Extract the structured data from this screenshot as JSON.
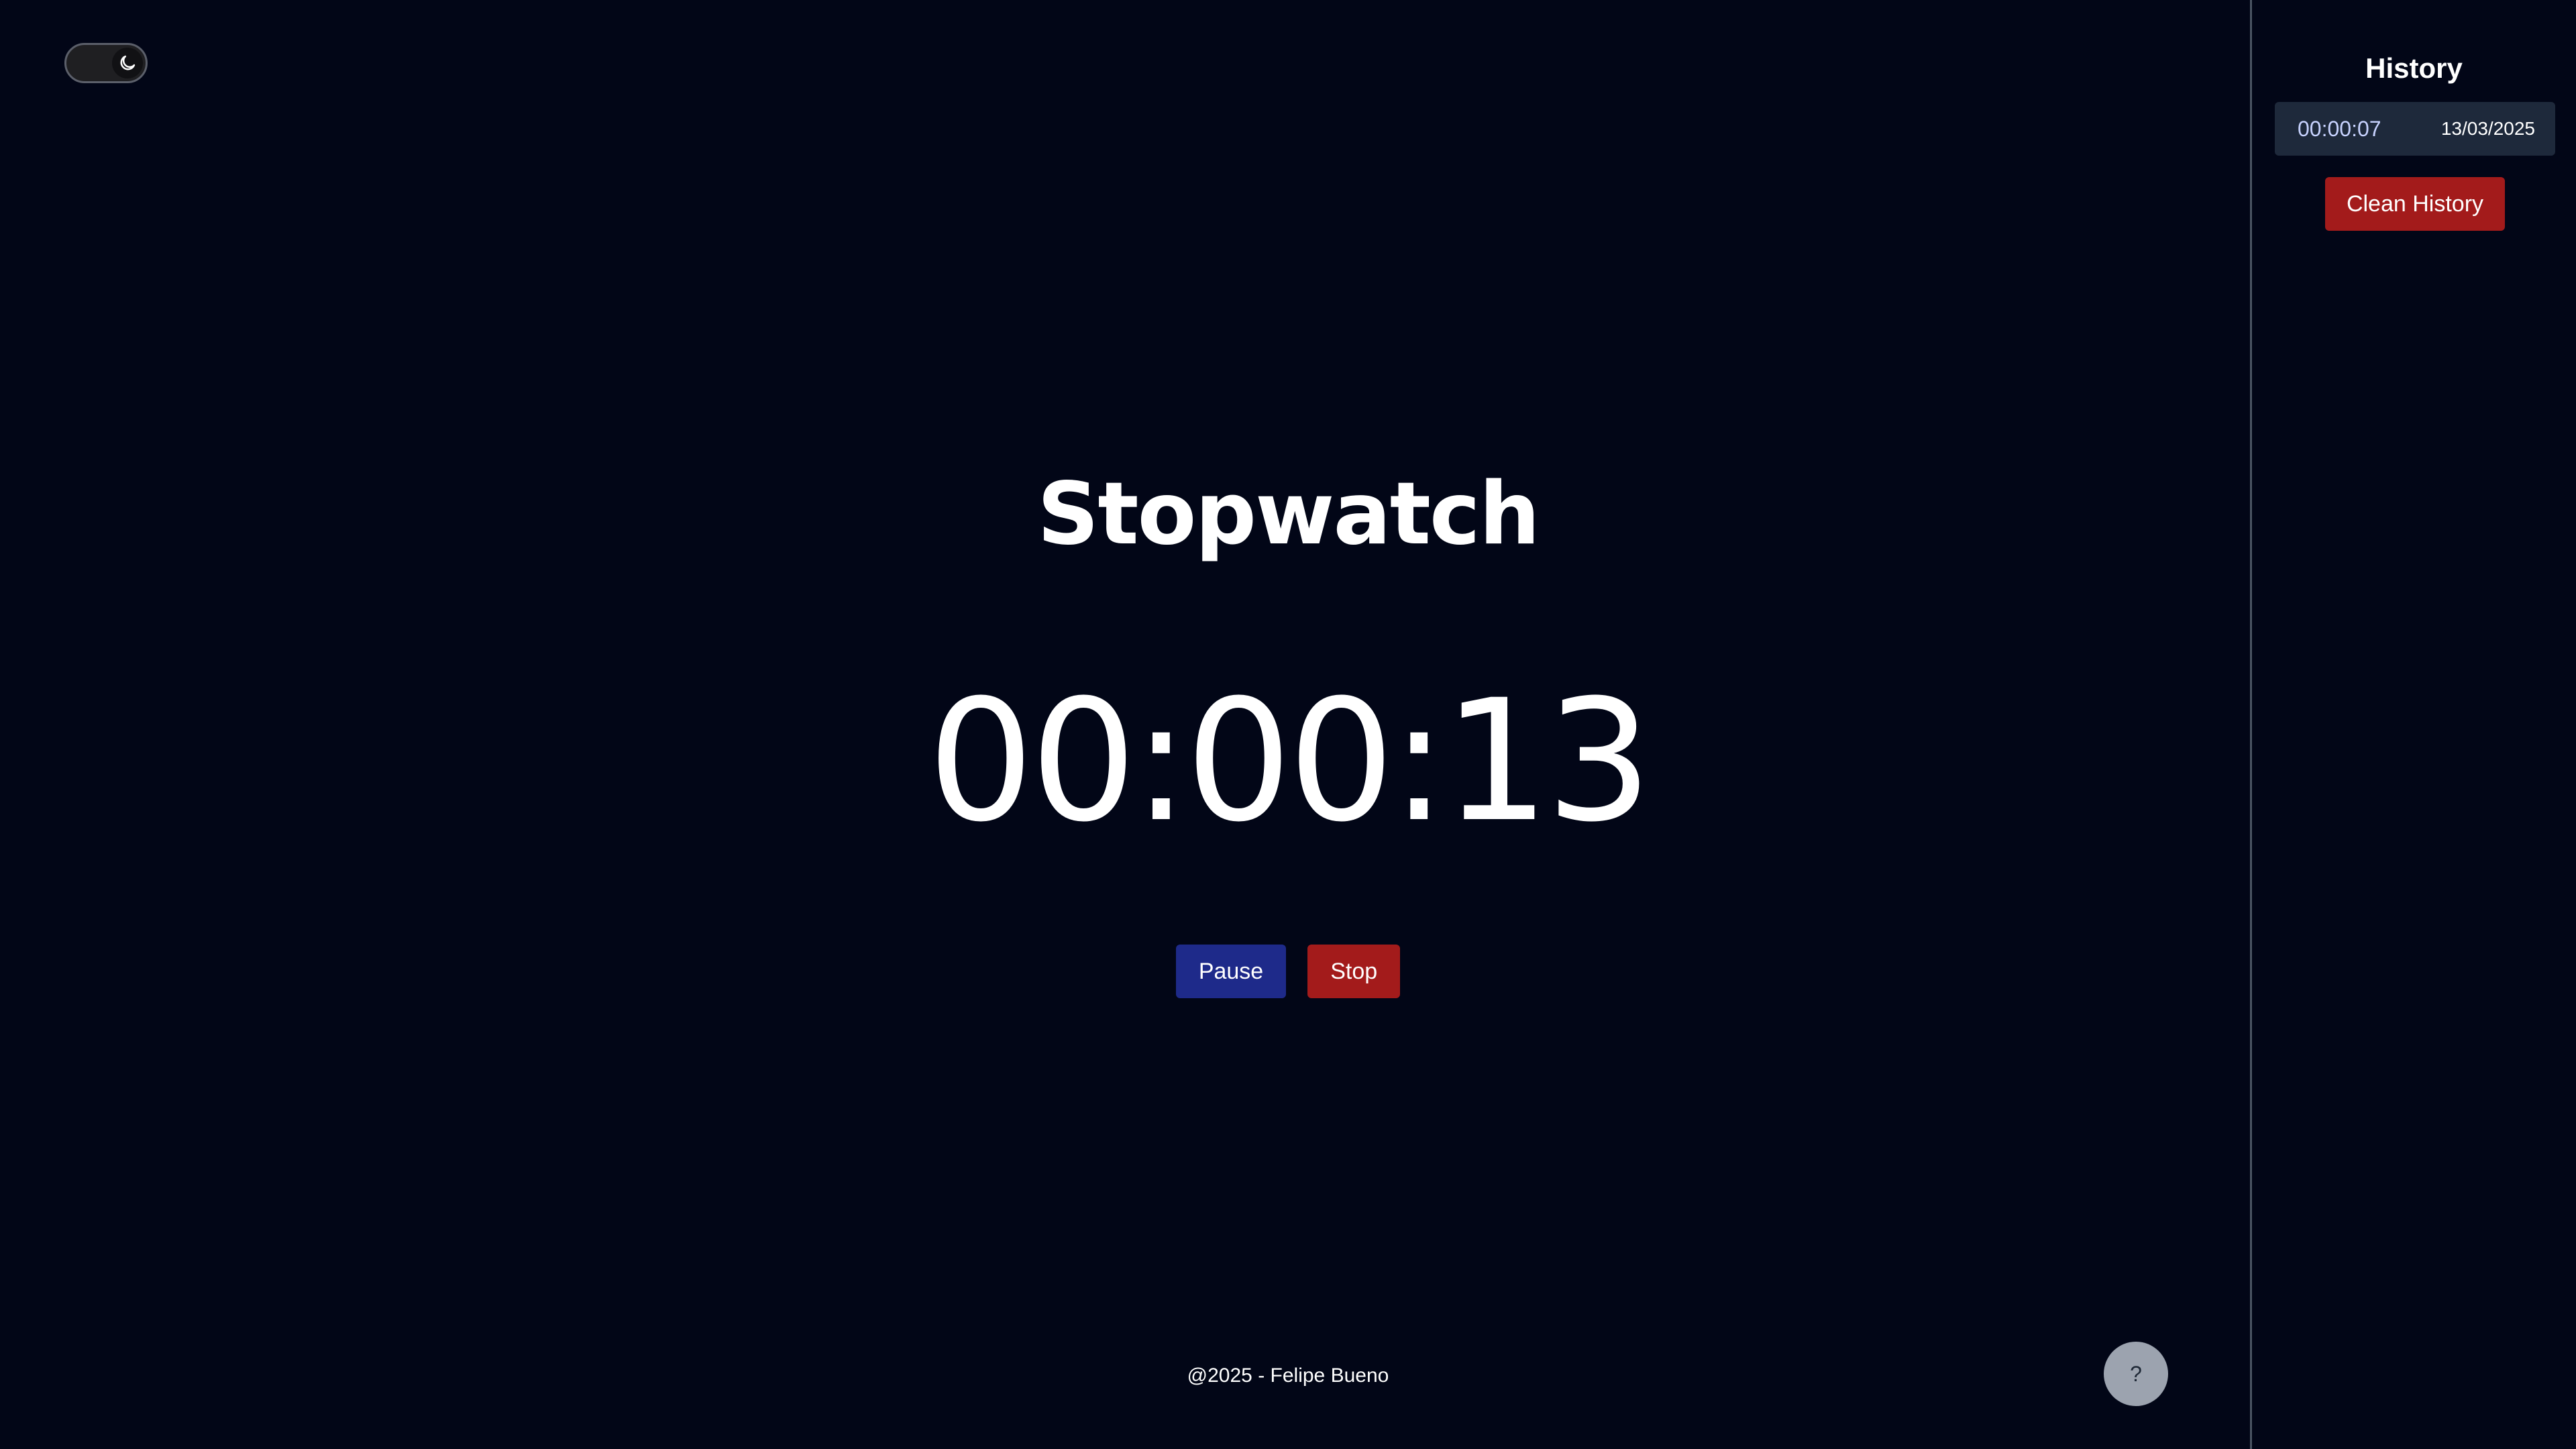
{
  "theme_toggle": {
    "icon": "moon-icon"
  },
  "main": {
    "title": "Stopwatch",
    "timer": "00:00:13",
    "pause_label": "Pause",
    "stop_label": "Stop",
    "footer": "@2025 - Felipe Bueno",
    "help_label": "?"
  },
  "sidebar": {
    "title": "History",
    "entries": [
      {
        "time": "00:00:07",
        "date": "13/03/2025"
      }
    ],
    "clean_label": "Clean History"
  },
  "colors": {
    "background": "#020617",
    "pause_button": "#1e2a8a",
    "stop_button": "#a31b1b",
    "history_row": "#1e293b",
    "help_button": "#9ca3af"
  }
}
